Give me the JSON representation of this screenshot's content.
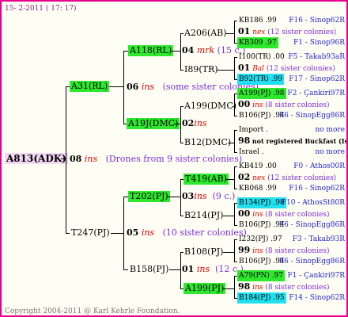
{
  "header": {
    "date": "15-  2-2011 ( 17: 17)"
  },
  "footer": "Copyright 2004-2011 @ Karl Kehrle Foundation.",
  "root": {
    "code": "A813(ADK)",
    "gen": "08",
    "ins": "ins",
    "desc": "(Drones from 9 sister colonies)"
  },
  "l1": [
    {
      "code": "A31(RL)",
      "gen": "06",
      "ins": "ins",
      "desc": "(some sister colonies)"
    },
    {
      "code": "T247(PJ)",
      "gen": "05",
      "ins": "ins",
      "desc": "(10 sister colonies)"
    }
  ],
  "l2": [
    {
      "code": "A118(RL)",
      "gen": "04",
      "ins": "mrk",
      "desc": "(15 c.)"
    },
    {
      "code": "A19J(DMC)",
      "gen": "02",
      "ins": "ins",
      "desc": ""
    },
    {
      "code": "T202(PJ)",
      "gen": "03",
      "ins": "ins",
      "desc": "(9 c.)"
    },
    {
      "code": "B158(PJ)",
      "gen": "01",
      "ins": "ins",
      "desc": "(12 c.)"
    }
  ],
  "l3": [
    {
      "code": "A206(AB)",
      "gen": "01",
      "ins": "nex",
      "desc": "(12 sister colonies)"
    },
    {
      "code": "I89(TR)",
      "gen": "01",
      "ins": "Bal",
      "desc": "(12 sister colonies)"
    },
    {
      "code": "A199(DMC)",
      "gen": "00",
      "ins": "ins",
      "desc": "(8 sister colonies)"
    },
    {
      "code": "B12(DMC)",
      "gen": "98",
      "ins": "",
      "desc": "not registered Buckfast (Israel or"
    },
    {
      "code": "T419(AB)",
      "gen": "02",
      "ins": "nex",
      "desc": "(12 sister colonies)"
    },
    {
      "code": "B214(PJ)",
      "gen": "00",
      "ins": "ins",
      "desc": "(8 sister colonies)"
    },
    {
      "code": "B108(PJ)",
      "gen": "99",
      "ins": "ins",
      "desc": "(8 sister colonies)"
    },
    {
      "code": "A199(PJ)",
      "gen": "98",
      "ins": "ins",
      "desc": "(8 sister colonies)"
    }
  ],
  "l4": [
    {
      "code": "KB186 .99",
      "right": "F16 - Sinop62R"
    },
    {
      "code": "KB309 .97",
      "right": "F1 - Sinop96R"
    },
    {
      "code": "I100(TR) .00",
      "right": "F5 - Takab93aR"
    },
    {
      "code": "B92(TR) .99",
      "right": "F17 - Sinop62R"
    },
    {
      "code": "A199(PJ) .98",
      "right": "F2 - Çankiri97R"
    },
    {
      "code": "B106(PJ) .94",
      "right": "F6 - SinopEgg86R"
    },
    {
      "code": "Import .",
      "right": "no more"
    },
    {
      "code": "Israel .",
      "right": "no more"
    },
    {
      "code": "KB419 .00",
      "right": "F0 - Athos00R"
    },
    {
      "code": "KB068 .99",
      "right": "F16 - Sinop62R"
    },
    {
      "code": "B134(PJ) .98",
      "right": "F10 - AthosSt80R"
    },
    {
      "code": "B106(PJ) .94",
      "right": "F6 - SinopEgg86R"
    },
    {
      "code": "I232(PJ) .97",
      "right": "F3 - Takab93R"
    },
    {
      "code": "B106(PJ) .94",
      "right": "F6 - SinopEgg86R"
    },
    {
      "code": "A79(PN) .97",
      "right": "F1 - Çankiri97R"
    },
    {
      "code": "B184(PJ) .95",
      "right": "F14 - Sinop62R"
    }
  ],
  "colors": {
    "border": "#e4008c",
    "green": "#2ee82e",
    "cyan": "#22e0f0",
    "red": "#e00000",
    "purple": "#7a2be0",
    "blue": "#1f1fd2"
  }
}
